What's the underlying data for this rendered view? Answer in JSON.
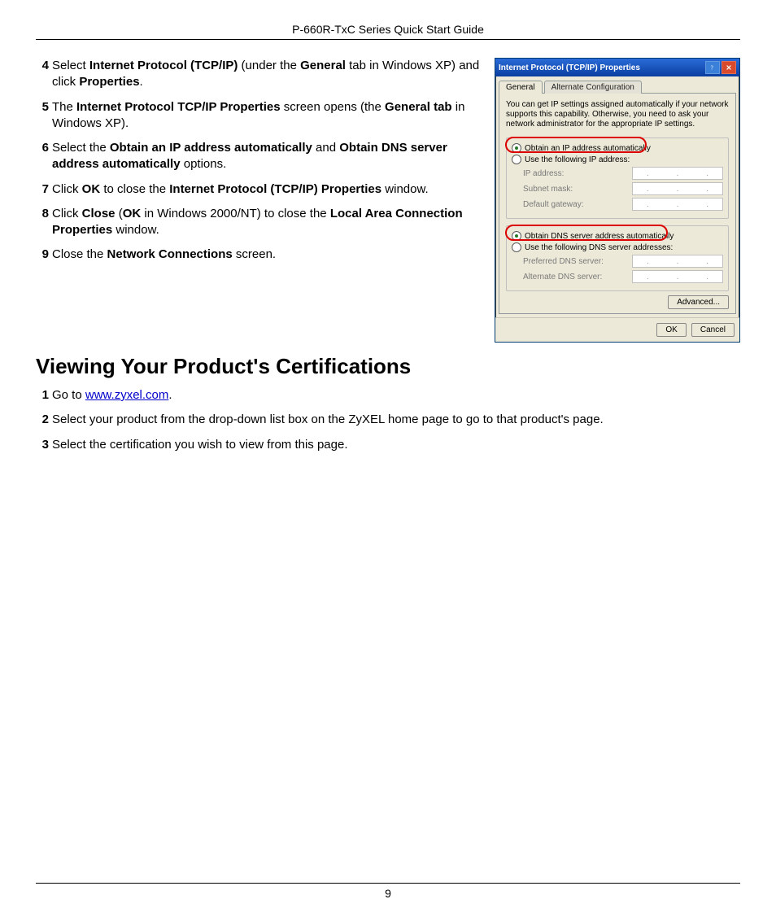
{
  "header": {
    "title": "P-660R-TxC Series Quick Start Guide"
  },
  "footer": {
    "page_number": "9"
  },
  "steps_a": [
    {
      "n": "4",
      "parts": [
        "Select ",
        "Internet Protocol (TCP/IP)",
        " (under the ",
        "General",
        " tab in Windows XP) and click ",
        "Properties",
        "."
      ],
      "bold": [
        1,
        3,
        5
      ]
    },
    {
      "n": "5",
      "parts": [
        "The ",
        "Internet Protocol TCP/IP Properties",
        " screen opens (the ",
        "General tab",
        " in Windows XP)."
      ],
      "bold": [
        1,
        3
      ]
    },
    {
      "n": "6",
      "parts": [
        "Select the ",
        "Obtain an IP address automatically",
        " and ",
        "Obtain DNS server address automatically",
        " options."
      ],
      "bold": [
        1,
        3
      ]
    },
    {
      "n": "7",
      "parts": [
        "Click ",
        "OK",
        " to close the ",
        "Internet Protocol (TCP/IP) Properties",
        " window."
      ],
      "bold": [
        1,
        3
      ]
    },
    {
      "n": "8",
      "parts": [
        "Click ",
        "Close",
        " (",
        "OK",
        " in Windows 2000/NT) to close the ",
        "Local Area Connection Properties",
        " window."
      ],
      "bold": [
        1,
        3,
        5
      ]
    },
    {
      "n": "9",
      "parts": [
        "Close the ",
        "Network Connections",
        " screen."
      ],
      "bold": [
        1
      ]
    }
  ],
  "section_heading": "Viewing Your Product's Certifications",
  "steps_b": [
    {
      "n": "1",
      "pre": "Go to ",
      "link": "www.zyxel.com",
      "post": "."
    },
    {
      "n": "2",
      "text": "Select your product from the drop-down list box on the ZyXEL home page to go to that product's page."
    },
    {
      "n": "3",
      "text": "Select the certification you wish to view from this page."
    }
  ],
  "dialog": {
    "title": "Internet Protocol (TCP/IP) Properties",
    "tabs": {
      "active": "General",
      "inactive": "Alternate Configuration"
    },
    "description": "You can get IP settings assigned automatically if your network supports this capability. Otherwise, you need to ask your network administrator for the appropriate IP settings.",
    "ip_group": {
      "opt_auto": "Obtain an IP address automatically",
      "opt_manual": "Use the following IP address:",
      "fields": {
        "ip": "IP address:",
        "mask": "Subnet mask:",
        "gw": "Default gateway:"
      }
    },
    "dns_group": {
      "opt_auto": "Obtain DNS server address automatically",
      "opt_manual": "Use the following DNS server addresses:",
      "fields": {
        "pref": "Preferred DNS server:",
        "alt": "Alternate DNS server:"
      }
    },
    "advanced": "Advanced...",
    "ok": "OK",
    "cancel": "Cancel"
  }
}
